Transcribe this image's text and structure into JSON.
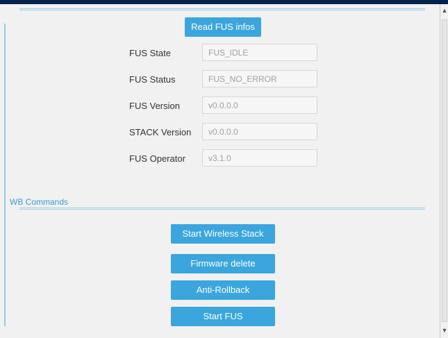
{
  "fus": {
    "read_button": "Read FUS infos",
    "rows": [
      {
        "label": "FUS State",
        "value": "FUS_IDLE"
      },
      {
        "label": "FUS Status",
        "value": "FUS_NO_ERROR"
      },
      {
        "label": "FUS Version",
        "value": "v0.0.0.0"
      },
      {
        "label": "STACK Version",
        "value": "v0.0.0.0"
      },
      {
        "label": "FUS Operator",
        "value": "v3.1.0"
      }
    ]
  },
  "wb": {
    "title": "WB Commands",
    "buttons": [
      "Start Wireless Stack",
      "Firmware delete",
      "Anti-Rollback",
      "Start FUS"
    ]
  },
  "scrollbar": {
    "up_icon": "chevron-up-icon",
    "down_icon": "chevron-down-icon"
  }
}
